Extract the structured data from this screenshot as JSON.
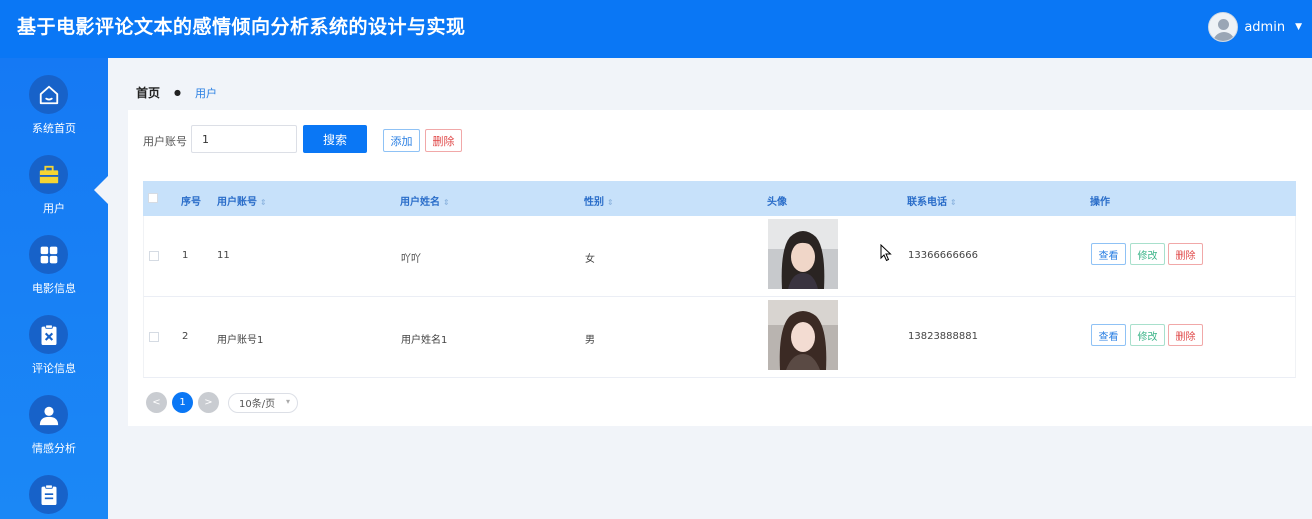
{
  "header": {
    "title": "基于电影评论文本的感情倾向分析系统的设计与实现",
    "username": "admin"
  },
  "sidebar": {
    "items": [
      {
        "label": "系统首页",
        "icon": "home-icon"
      },
      {
        "label": "用户",
        "icon": "briefcase-icon"
      },
      {
        "label": "电影信息",
        "icon": "grid-icon"
      },
      {
        "label": "评论信息",
        "icon": "clipboard-x-icon"
      },
      {
        "label": "情感分析",
        "icon": "user-icon"
      },
      {
        "label": "",
        "icon": "clipboard-list-icon"
      }
    ],
    "active_index": 1
  },
  "breadcrumb": {
    "home": "首页",
    "current": "用户"
  },
  "search": {
    "label": "用户账号",
    "value": "1",
    "button": "搜索",
    "add": "添加",
    "delete": "删除"
  },
  "table": {
    "headers": {
      "index": "序号",
      "account": "用户账号",
      "name": "用户姓名",
      "gender": "性别",
      "avatar": "头像",
      "phone": "联系电话",
      "actions": "操作"
    },
    "rows": [
      {
        "index": "1",
        "account": "11",
        "name": "吖吖",
        "gender": "女",
        "phone": "13366666666"
      },
      {
        "index": "2",
        "account": "用户账号1",
        "name": "用户姓名1",
        "gender": "男",
        "phone": "13823888881"
      }
    ],
    "action_labels": {
      "view": "查看",
      "edit": "修改",
      "delete": "删除"
    }
  },
  "pagination": {
    "prev": "<",
    "current": "1",
    "next": ">",
    "page_size": "10条/页"
  },
  "colors": {
    "primary": "#0a77f5",
    "header_bg": "#0a77f5",
    "table_header_bg": "#c7e1fa",
    "danger": "#e04848",
    "success": "#3cb489"
  }
}
